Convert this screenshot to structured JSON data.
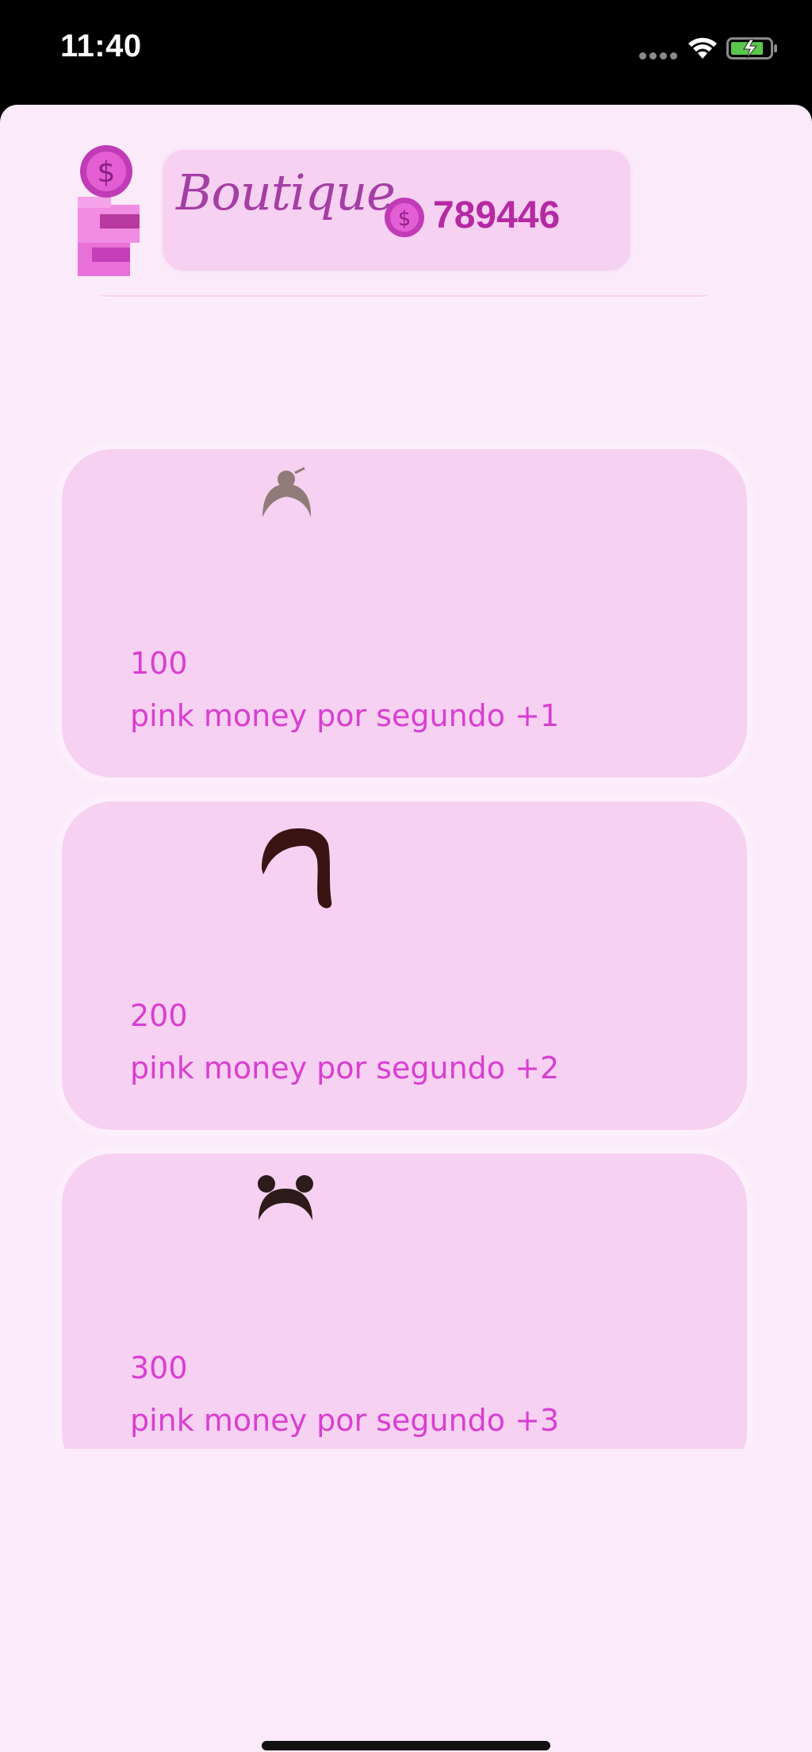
{
  "status_bar": {
    "time": "11:40"
  },
  "header": {
    "title": "Boutique",
    "balance": "789446",
    "logo_icon": "coin-stack-icon",
    "balance_icon": "coin-icon"
  },
  "colors": {
    "sheet_bg": "#fbeaf9",
    "card_bg": "#f6d1f1",
    "accent_text": "#d83fd0",
    "title_text": "#a53ea4"
  },
  "items": [
    {
      "price": "100",
      "description": "pink money por segundo +1",
      "icon": "bun-hair-icon"
    },
    {
      "price": "200",
      "description": "pink money por segundo +2",
      "icon": "ponytail-hair-icon"
    },
    {
      "price": "300",
      "description": "pink money por segundo +3",
      "icon": "space-buns-hair-icon"
    },
    {
      "price": "",
      "description": "",
      "icon": "blonde-pigtails-hair-icon"
    }
  ]
}
